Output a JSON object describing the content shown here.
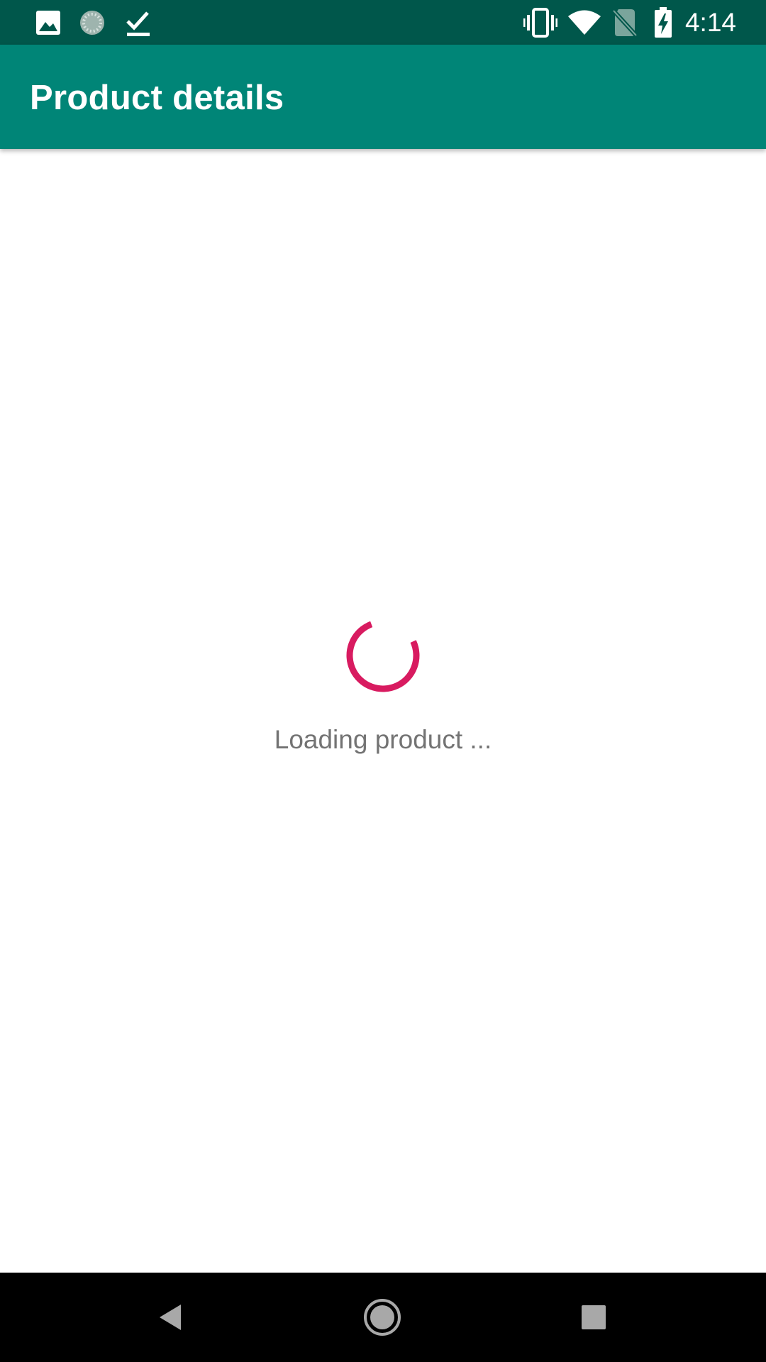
{
  "status_bar": {
    "left_icons": [
      "image-icon",
      "loading-circle-icon",
      "download-done-icon"
    ],
    "right_icons": [
      "vibrate-icon",
      "wifi-icon",
      "no-sim-icon",
      "battery-charging-icon"
    ],
    "time": "4:14"
  },
  "app_bar": {
    "title": "Product details",
    "color": "#008577"
  },
  "content": {
    "spinner_icon": "progress-spinner-icon",
    "spinner_color": "#d81b60",
    "loading_text": "Loading product ..."
  },
  "nav_bar": {
    "back_icon": "back-triangle-icon",
    "home_icon": "home-circle-icon",
    "recents_icon": "recents-square-icon"
  }
}
